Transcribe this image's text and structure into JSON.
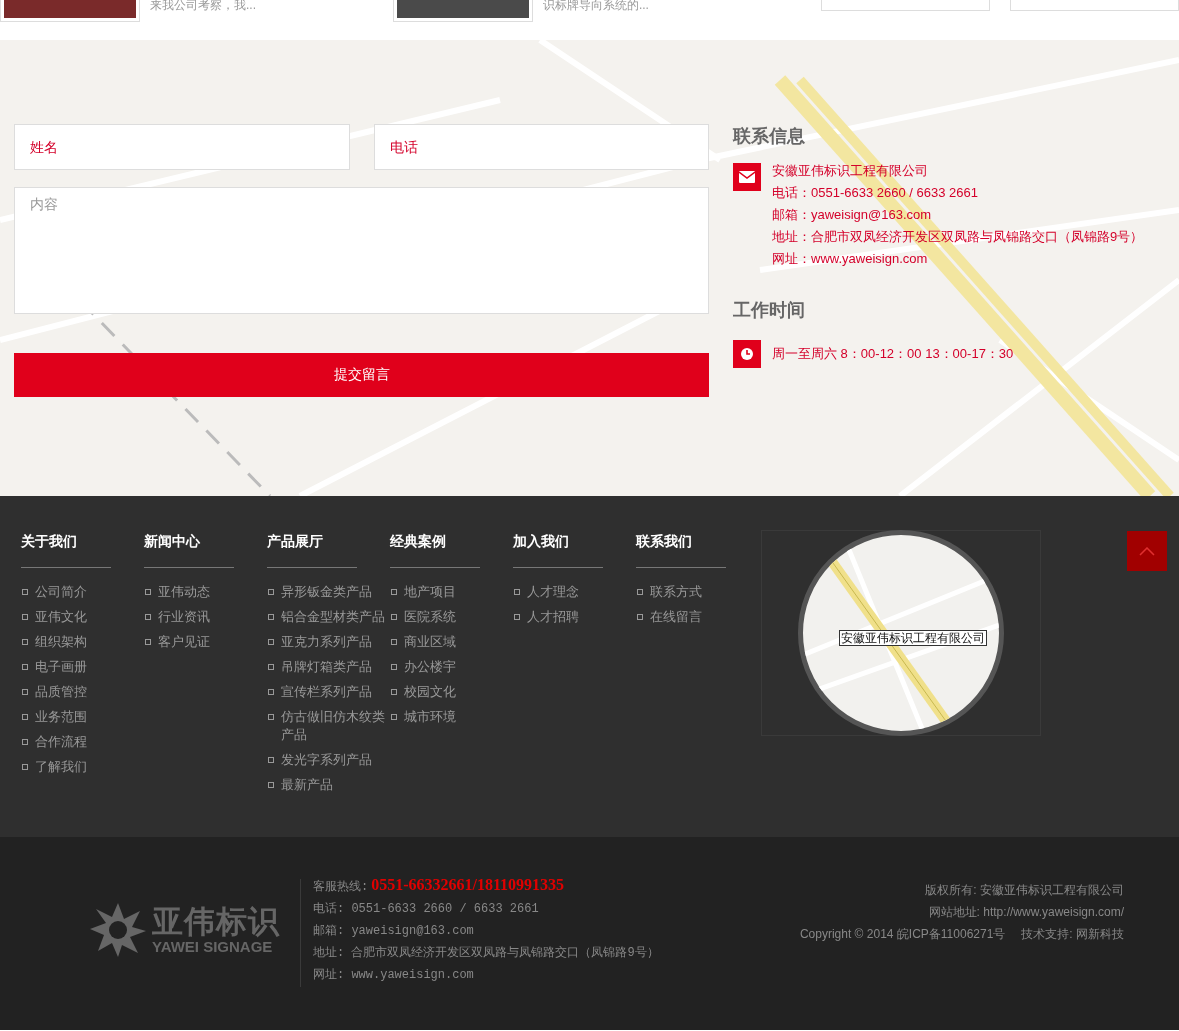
{
  "top_strip": {
    "items": [
      {
        "caption": "来我公司考察，我..."
      },
      {
        "caption": "识标牌导向系统的..."
      }
    ]
  },
  "message_form": {
    "fields": [
      {
        "placeholder": "姓名"
      },
      {
        "placeholder": "电话"
      }
    ],
    "message": {
      "placeholder": "内容"
    },
    "submit": "提交留言"
  },
  "contact_info": {
    "title": "联系信息",
    "company": "安徽亚伟标识工程有限公司",
    "lines": [
      "电话：0551-6633 2660 / 6633 2661",
      "邮箱：yaweisign@163.com",
      "地址：合肥市双凤经济开发区双凤路与凤锦路交口（凤锦路9号）",
      "网址：www.yaweisign.com"
    ],
    "hours_title": "工作时间",
    "hours": "周一至周六 8：00-12：00 13：00-17：30"
  },
  "footer_nav": {
    "columns": [
      {
        "heading": "关于我们",
        "items": [
          "公司简介",
          "亚伟文化",
          "组织架构",
          "电子画册",
          "品质管控",
          "业务范围",
          "合作流程",
          "了解我们"
        ]
      },
      {
        "heading": "新闻中心",
        "items": [
          "亚伟动态",
          "行业资讯",
          "客户见证"
        ]
      },
      {
        "heading": "产品展厅",
        "items": [
          "异形钣金类产品",
          "铝合金型材类产品",
          "亚克力系列产品",
          "吊牌灯箱类产品",
          "宣传栏系列产品",
          "仿古做旧仿木纹类产品",
          "发光字系列产品",
          "最新产品"
        ]
      },
      {
        "heading": "经典案例",
        "items": [
          "地产项目",
          "医院系统",
          "商业区域",
          "办公楼宇",
          "校园文化",
          "城市环境"
        ]
      },
      {
        "heading": "加入我们",
        "items": [
          "人才理念",
          "人才招聘"
        ]
      },
      {
        "heading": "联系我们",
        "items": [
          "联系方式",
          "在线留言"
        ]
      }
    ],
    "map_marker": "安徽亚伟标识工程有限公司"
  },
  "footer_bottom": {
    "logo": {
      "name": "亚伟标识",
      "tagline": "YAWEI SIGNAGE"
    },
    "hotline_label": "客服热线:",
    "hotline": "0551-66332661/18110991335",
    "lines": [
      "电话: 0551-6633 2660 / 6633 2661",
      "邮箱: yaweisign@163.com",
      "地址: 合肥市双凤经济开发区双凤路与凤锦路交口（凤锦路9号）",
      "网址: www.yaweisign.com"
    ],
    "copyright": "版权所有:  安徽亚伟标识工程有限公司",
    "website": "网站地址: http://www.yaweisign.com/",
    "icp": "Copyright © 2014 皖ICP备11006271号",
    "support": "技术支持: 网新科技"
  }
}
